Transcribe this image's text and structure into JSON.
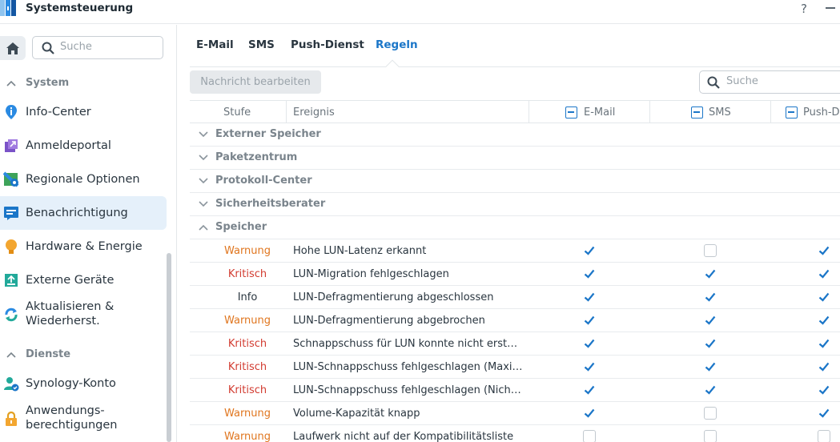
{
  "window": {
    "title": "Systemsteuerung",
    "help": "?"
  },
  "sidebar": {
    "search_placeholder": "Suche",
    "sections": [
      {
        "label": "System",
        "items": [
          {
            "label": "Info-Center",
            "icon": "info-icon"
          },
          {
            "label": "Anmeldeportal",
            "icon": "login-portal-icon"
          },
          {
            "label": "Regionale Optionen",
            "icon": "regional-options-icon"
          },
          {
            "label": "Benachrichtigung",
            "icon": "notification-icon",
            "active": true
          },
          {
            "label": "Hardware & Energie",
            "icon": "hardware-power-icon"
          },
          {
            "label": "Externe Geräte",
            "icon": "external-devices-icon"
          },
          {
            "label": "Aktualisieren & Wiederherst.",
            "icon": "update-restore-icon"
          }
        ]
      },
      {
        "label": "Dienste",
        "items": [
          {
            "label": "Synology-Konto",
            "icon": "synology-account-icon"
          },
          {
            "label": "Anwendungs-berechtigungen",
            "icon": "app-permissions-icon"
          }
        ]
      }
    ]
  },
  "tabs": [
    {
      "label": "E-Mail"
    },
    {
      "label": "SMS"
    },
    {
      "label": "Push-Dienst"
    },
    {
      "label": "Regeln",
      "active": true
    }
  ],
  "toolbar": {
    "edit_label": "Nachricht bearbeiten",
    "search_placeholder": "Suche"
  },
  "grid": {
    "columns": {
      "level": "Stufe",
      "event": "Ereignis",
      "email": "E-Mail",
      "sms": "SMS",
      "push": "Push-D"
    },
    "groups": [
      {
        "label": "Externer Speicher",
        "expanded": false
      },
      {
        "label": "Paketzentrum",
        "expanded": false
      },
      {
        "label": "Protokoll-Center",
        "expanded": false
      },
      {
        "label": "Sicherheitsberater",
        "expanded": false
      },
      {
        "label": "Speicher",
        "expanded": true
      }
    ],
    "rows": [
      {
        "level": "Warnung",
        "severity": "warn",
        "event": "Hohe LUN-Latenz erkannt",
        "email": true,
        "sms": false,
        "push": true
      },
      {
        "level": "Kritisch",
        "severity": "crit",
        "event": "LUN-Migration fehlgeschlagen",
        "email": true,
        "sms": true,
        "push": true
      },
      {
        "level": "Info",
        "severity": "info",
        "event": "LUN-Defragmentierung abgeschlossen",
        "email": true,
        "sms": true,
        "push": true
      },
      {
        "level": "Warnung",
        "severity": "warn",
        "event": "LUN-Defragmentierung abgebrochen",
        "email": true,
        "sms": true,
        "push": true
      },
      {
        "level": "Kritisch",
        "severity": "crit",
        "event": "Schnappschuss für LUN konnte nicht erst…",
        "email": true,
        "sms": true,
        "push": true
      },
      {
        "level": "Kritisch",
        "severity": "crit",
        "event": "LUN-Schnappschuss fehlgeschlagen (Maxi…",
        "email": true,
        "sms": true,
        "push": true
      },
      {
        "level": "Kritisch",
        "severity": "crit",
        "event": "LUN-Schnappschuss fehlgeschlagen (Nich…",
        "email": true,
        "sms": true,
        "push": true
      },
      {
        "level": "Warnung",
        "severity": "warn",
        "event": "Volume-Kapazität knapp",
        "email": true,
        "sms": false,
        "push": true
      },
      {
        "level": "Warnung",
        "severity": "warn",
        "event": "Laufwerk nicht auf der Kompatibilitätsliste",
        "email": false,
        "sms": false,
        "push": false
      }
    ]
  },
  "colors": {
    "accent": "#1b76c8",
    "warning": "#e0761f",
    "critical": "#d23b30"
  }
}
